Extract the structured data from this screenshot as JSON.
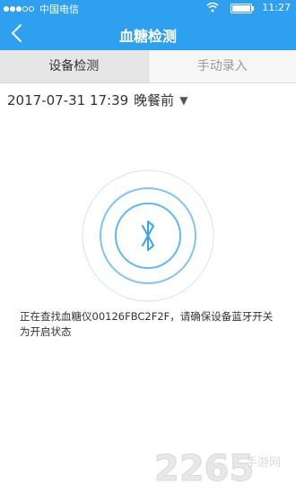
{
  "status_bar": {
    "carrier": "中国电信",
    "time": "11:27"
  },
  "nav": {
    "title": "血糖检测"
  },
  "tabs": [
    {
      "label": "设备检测",
      "active": true
    },
    {
      "label": "手动录入",
      "active": false
    }
  ],
  "measurement": {
    "datetime": "2017-07-31 17:39",
    "meal_period": "晚餐前"
  },
  "search_message": "正在查找血糖仪00126FBC2F2F，请确保设备蓝牙开关为开启状态",
  "watermark": {
    "digits": "2265",
    "suffix": "手游网"
  },
  "colors": {
    "primary": "#2f9ff0",
    "radar_ring": "#5fb8f3"
  },
  "icons": {
    "back": "chevron-left-icon",
    "bluetooth": "bluetooth-icon",
    "dropdown": "triangle-down-icon",
    "wifi": "wifi-icon",
    "battery": "battery-icon"
  }
}
